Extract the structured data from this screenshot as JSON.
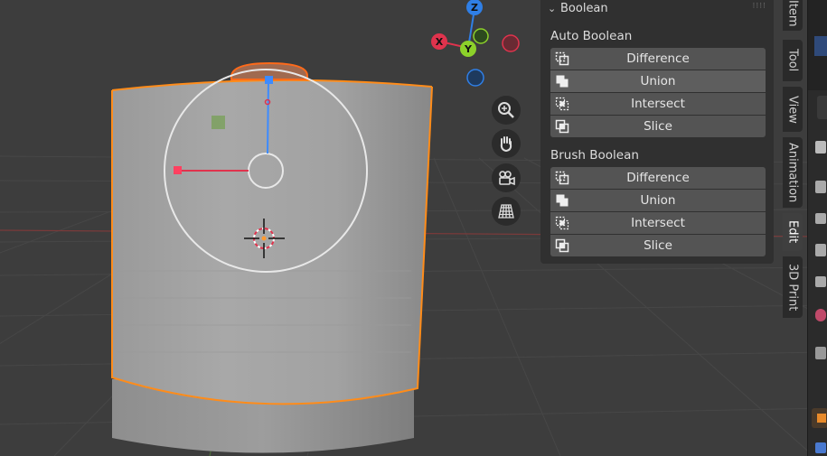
{
  "gizmo": {
    "axis_z": "Z",
    "axis_x": "X",
    "axis_y": "Y",
    "color_x": "#e0334d",
    "color_y": "#8cd12a",
    "color_z": "#2f7fe6"
  },
  "nav_buttons": [
    {
      "icon": "zoom-icon"
    },
    {
      "icon": "hand-pan-icon"
    },
    {
      "icon": "camera-icon"
    },
    {
      "icon": "grid-perspective-icon"
    }
  ],
  "panel": {
    "header": "Boolean",
    "auto_boolean": {
      "title": "Auto Boolean",
      "buttons": [
        "Difference",
        "Union",
        "Intersect",
        "Slice"
      ]
    },
    "brush_boolean": {
      "title": "Brush Boolean",
      "buttons": [
        "Difference",
        "Union",
        "Intersect",
        "Slice"
      ]
    }
  },
  "tabs": [
    "Item",
    "Tool",
    "View",
    "Animation",
    "Edit",
    "3D Print"
  ],
  "active_tab": "Edit",
  "colors": {
    "selection_outline": "#ff8c1a",
    "panel_bg": "#303030",
    "button_bg": "#545454",
    "viewport_bg": "#3d3d3d"
  }
}
